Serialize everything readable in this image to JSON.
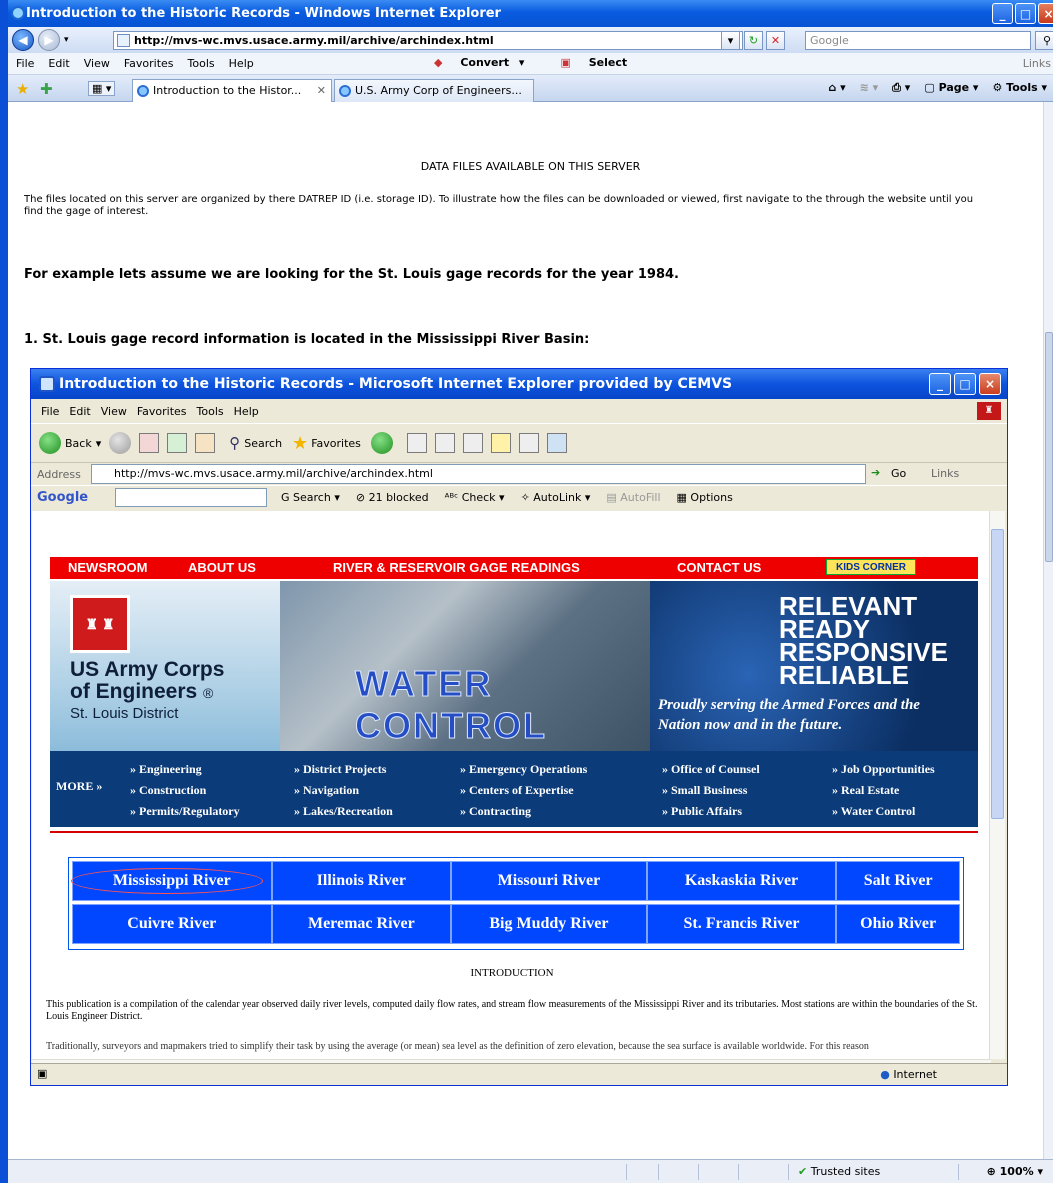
{
  "window": {
    "title": "Introduction to the Historic Records - Windows Internet Explorer"
  },
  "address": {
    "url": "http://mvs-wc.mvs.usace.army.mil/archive/archindex.html"
  },
  "search": {
    "placeholder": "Google"
  },
  "menu": {
    "items": [
      "File",
      "Edit",
      "View",
      "Favorites",
      "Tools",
      "Help"
    ],
    "convert": "Convert",
    "select": "Select",
    "links": "Links"
  },
  "tabs": [
    {
      "label": "Introduction to the Histor..."
    },
    {
      "label": "U.S. Army Corp of Engineers..."
    }
  ],
  "command_bar": {
    "page": "Page",
    "tools": "Tools"
  },
  "page": {
    "heading": "DATA FILES AVAILABLE ON THIS SERVER",
    "p1": "The files located on this server are organized by there DATREP ID (i.e. storage ID). To illustrate how the files can be downloaded or viewed, first navigate to the through the website until you find the gage of interest.",
    "p2": "For example lets assume we are looking for the St. Louis gage records for the year 1984.",
    "p3": "1. St. Louis gage record information is located in the Mississippi River Basin:"
  },
  "inner": {
    "title": "Introduction to the Historic Records - Microsoft Internet Explorer provided by CEMVS",
    "menu": [
      "File",
      "Edit",
      "View",
      "Favorites",
      "Tools",
      "Help"
    ],
    "toolbar": {
      "back": "Back",
      "search": "Search",
      "favorites": "Favorites"
    },
    "address_label": "Address",
    "url": "http://mvs-wc.mvs.usace.army.mil/archive/archindex.html",
    "go": "Go",
    "links": "Links",
    "google": {
      "logo": "Google",
      "search": "Search",
      "blocked": "21 blocked",
      "check": "Check",
      "autolink": "AutoLink",
      "autofill": "AutoFill",
      "options": "Options"
    },
    "status_zone": "Internet"
  },
  "site": {
    "nav": {
      "newsroom": "NEWSROOM",
      "about": "ABOUT US",
      "gage": "RIVER & RESERVOIR GAGE READINGS",
      "contact": "CONTACT US",
      "kids": "KIDS CORNER"
    },
    "logo": {
      "line1": "US Army Corps",
      "line2": "of Engineers",
      "reg": "®",
      "line3": "St. Louis District"
    },
    "photo_caption": "WATER CONTROL",
    "slogan": [
      "RELEVANT",
      "READY",
      "RESPONSIVE",
      "RELIABLE"
    ],
    "tagline": "Proudly serving the Armed Forces and the Nation now and in the future.",
    "more": "MORE »",
    "links": [
      [
        "» Engineering",
        "» Construction",
        "» Permits/Regulatory"
      ],
      [
        "» District Projects",
        "» Navigation",
        "» Lakes/Recreation"
      ],
      [
        "» Emergency Operations",
        "» Centers of Expertise",
        "» Contracting"
      ],
      [
        "» Office of Counsel",
        "» Small Business",
        "» Public Affairs"
      ],
      [
        "» Job Opportunities",
        "» Real Estate",
        "» Water Control"
      ]
    ],
    "rivers_row1": [
      "Mississippi River",
      "Illinois River",
      "Missouri River",
      "Kaskaskia River",
      "Salt River"
    ],
    "rivers_row2": [
      "Cuivre River",
      "Meremac River",
      "Big Muddy River",
      "St. Francis River",
      "Ohio River"
    ],
    "intro_title": "INTRODUCTION",
    "intro_p": "This publication is a compilation of the calendar year observed daily river levels, computed daily flow rates, and stream flow measurements of the Mississippi River and its tributaries. Most stations are within the boundaries of the St. Louis Engineer District.",
    "intro_p2": "Traditionally, surveyors and mapmakers tried to simplify their task by using the average (or mean) sea level as the definition of zero elevation, because the sea surface is available worldwide. For this reason"
  },
  "status": {
    "trusted": "Trusted sites",
    "zoom": "100%"
  }
}
